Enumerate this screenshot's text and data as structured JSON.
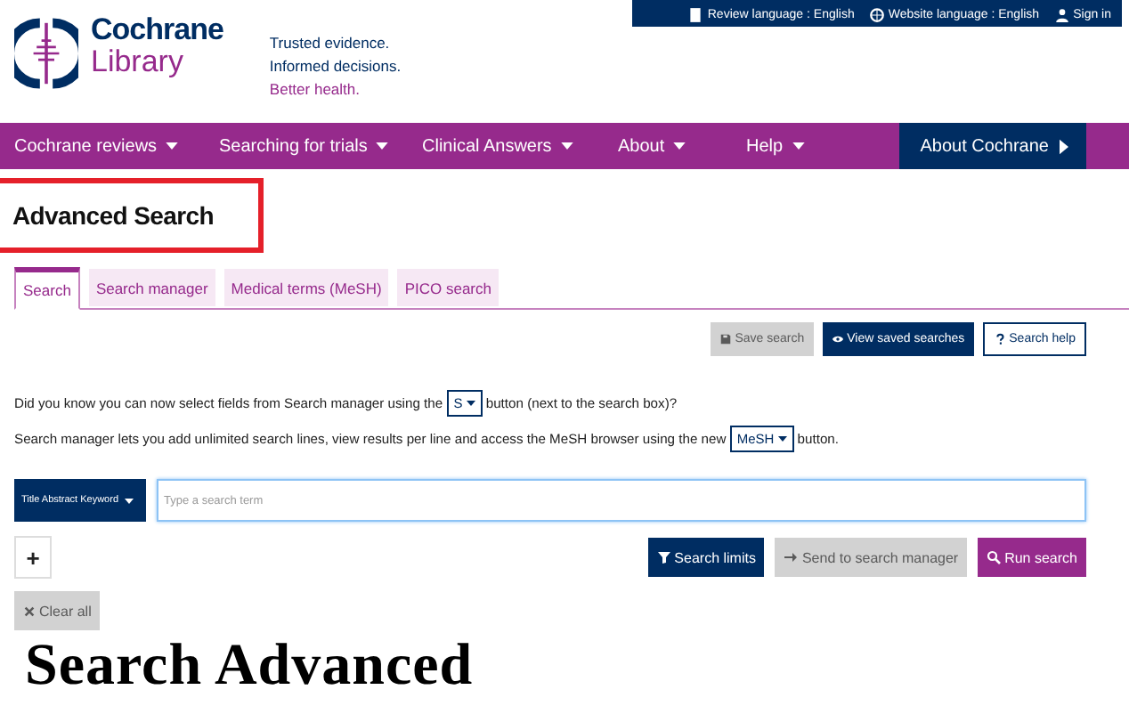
{
  "utility_bar": [
    {
      "kind": "doc",
      "label": "Review language : English"
    },
    {
      "kind": "globe",
      "label": "Website language : English"
    },
    {
      "kind": "user",
      "label": "Sign in"
    }
  ],
  "logo": {
    "line1": "Cochrane",
    "line2": "Library"
  },
  "tagline": [
    "Trusted evidence.",
    "Informed decisions.",
    "Better health."
  ],
  "nav": [
    {
      "label": "Cochrane reviews"
    },
    {
      "label": "Searching for trials"
    },
    {
      "label": "Clinical Answers"
    },
    {
      "label": "About"
    },
    {
      "label": "Help"
    }
  ],
  "nav_feature": {
    "label": "About Cochrane"
  },
  "page_title": "Advanced Search",
  "tabs": [
    {
      "label": "Search",
      "selected": true
    },
    {
      "label": "Search manager",
      "selected": false
    },
    {
      "label": "Medical terms (MeSH)",
      "selected": false
    },
    {
      "label": "PICO search",
      "selected": false
    }
  ],
  "toolbar": [
    {
      "kind": "save",
      "label": "Save search",
      "disabled": true
    },
    {
      "kind": "eye",
      "label": "View saved searches",
      "disabled": false
    },
    {
      "kind": "help",
      "label": "Search help",
      "disabled": false
    }
  ],
  "info": [
    {
      "before": "Did you know you can now select fields from Search manager using the",
      "button": "S",
      "after": "button (next to the search box)?"
    },
    {
      "before": "Search manager lets you add unlimited search lines, view results per line and access the MeSH browser using the new",
      "button": "MeSH",
      "after": "button."
    }
  ],
  "search": {
    "field": "Title Abstract Keyword",
    "placeholder": "Type a search term"
  },
  "add_line": "+",
  "actions": [
    {
      "kind": "filter",
      "label": "Search limits",
      "disabled": false
    },
    {
      "kind": "arrow",
      "label": "Send to search manager",
      "disabled": true
    },
    {
      "kind": "search",
      "label": "Run search",
      "disabled": false
    }
  ],
  "clear": {
    "kind": "x",
    "label": "Clear all",
    "disabled": true
  },
  "caption": "Search Advanced"
}
